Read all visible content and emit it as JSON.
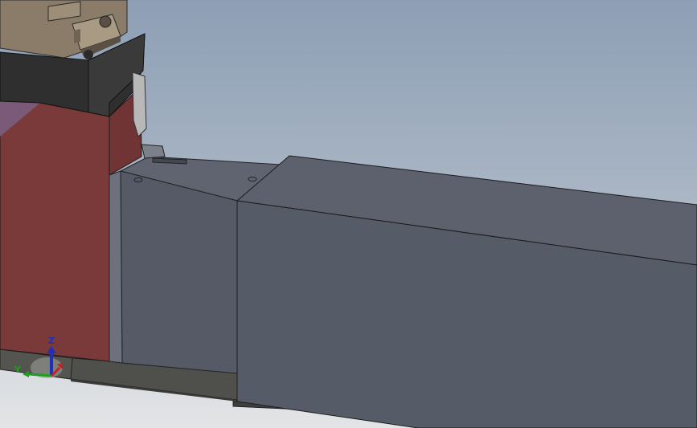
{
  "viewport": {
    "background_top": "#8fa0b5",
    "background_bottom": "#dcdfe3"
  },
  "parts": {
    "top_clamp_color": "#8b7d6b",
    "black_block_color": "#333333",
    "red_block_color": "#7a3b3a",
    "purple_face_color": "#7d5b7a",
    "main_body_color": "#545a66",
    "main_body_top_color": "#5d6370",
    "rail_color": "#4c4c4a"
  },
  "triad": {
    "z_label": "Z",
    "y_label": "Y",
    "x_label": "X",
    "z_color": "#1e2fb8",
    "y_color": "#1aa01a",
    "x_color": "#c42020"
  }
}
